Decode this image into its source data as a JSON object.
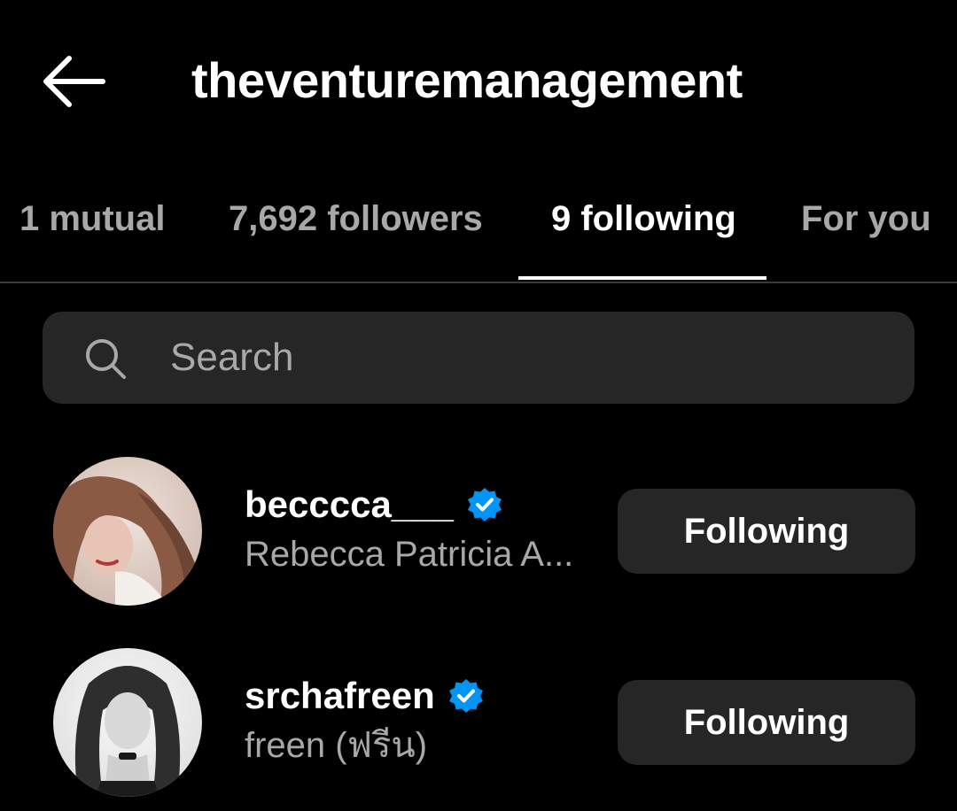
{
  "header": {
    "back_icon": "arrow-left-icon",
    "title": "theventuremanagement"
  },
  "tabs": [
    {
      "label": "1 mutual",
      "active": false
    },
    {
      "label": "7,692 followers",
      "active": false
    },
    {
      "label": "9 following",
      "active": true
    },
    {
      "label": "For you",
      "active": false
    }
  ],
  "search": {
    "icon": "search-icon",
    "placeholder": "Search",
    "value": ""
  },
  "users": [
    {
      "username": "becccca___",
      "verified": true,
      "full_name": "Rebecca Patricia A...",
      "button_label": "Following"
    },
    {
      "username": "srchafreen",
      "verified": true,
      "full_name": "freen (ฟรีน)",
      "button_label": "Following"
    }
  ],
  "colors": {
    "background": "#000000",
    "surface": "#262626",
    "text_primary": "#ffffff",
    "text_secondary": "#a8a8a8",
    "verified_blue": "#0095f6",
    "divider": "#3a3a3a"
  }
}
